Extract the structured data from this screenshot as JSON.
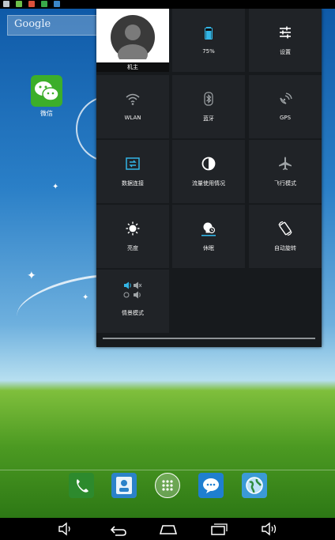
{
  "launcher": {
    "search_placeholder": "Google",
    "desktop_app_label": "微信"
  },
  "quick_settings": {
    "owner_label": "机主",
    "battery_level": "75%",
    "tiles": [
      {
        "label": "设置"
      },
      {
        "label": "WLAN"
      },
      {
        "label": "蓝牙"
      },
      {
        "label": "GPS"
      },
      {
        "label": "数据连接"
      },
      {
        "label": "流量使用情况"
      },
      {
        "label": "飞行模式"
      },
      {
        "label": "亮度"
      },
      {
        "label": "休眠"
      },
      {
        "label": "自动旋转"
      },
      {
        "label": "情景模式"
      }
    ]
  },
  "colors": {
    "accent": "#33b5e5",
    "panel_bg": "#171a1d",
    "tile_bg": "#202327"
  }
}
